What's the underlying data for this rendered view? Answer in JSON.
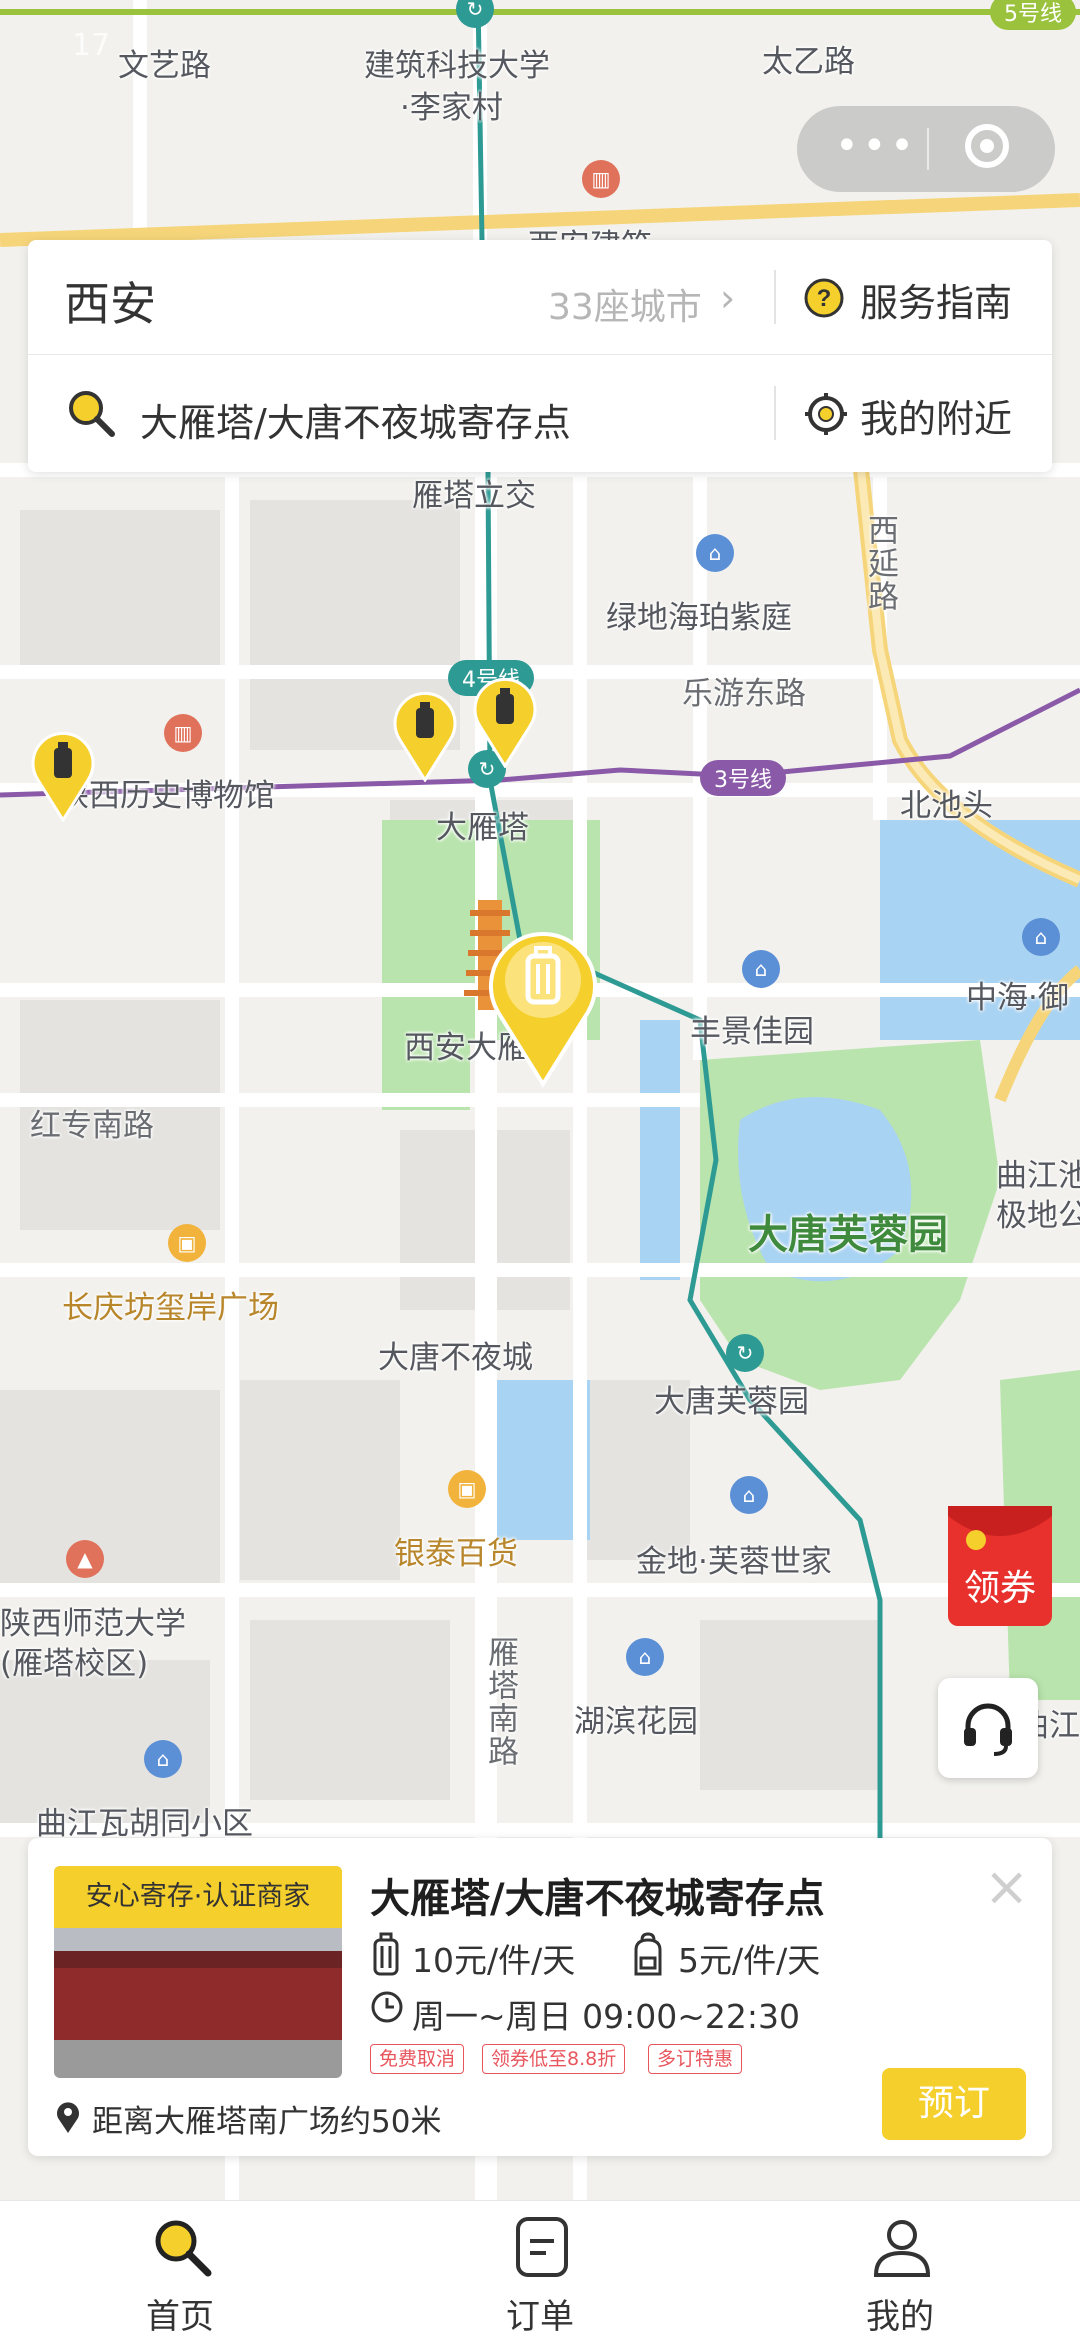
{
  "map": {
    "labels": {
      "wenyi_road": "文艺路",
      "jianzhu_station": "建筑科技大学",
      "lijiacun": "·李家村",
      "taiyi_road": "太乙路",
      "yanta_lijiao": "雁塔立交",
      "xiyan_road": "西延路",
      "lvdi": "绿地海珀紫庭",
      "leyou_road": "乐游东路",
      "museum": "陕西历史博物馆",
      "beichitou": "北池头",
      "dayanta_station": "大雁塔",
      "zhonghai": "中海·御",
      "xian_dayanta": "西安大雁塔",
      "fengjing": "丰景佳园",
      "hongzhuan_road": "红专南路",
      "qujiang_chi": "曲江池",
      "jidi": "极地公",
      "furong_park": "大唐芙蓉园",
      "changqingfang": "长庆坊玺岸广场",
      "budaocheng": "大唐不夜城",
      "furong_station": "大唐芙蓉园",
      "yintai": "银泰百货",
      "jindi": "金地·芙蓉世家",
      "shida": "陕西师范大学",
      "shida_campus": "(雁塔校区)",
      "yanta_south_road": "雁塔南路",
      "hubin": "湖滨花园",
      "wahutong": "曲江瓦胡同小区",
      "qujiang_right": "曲江",
      "xiyan_top": "西安建筑"
    },
    "line_badges": {
      "line5": "5号线",
      "line4": "4号线",
      "line3": "3号线"
    },
    "colors": {
      "line3": "#8a5aa8",
      "line4": "#2e9a94",
      "line5": "#9ac23c",
      "park": "#b9e4ad",
      "water": "#a9d3f2",
      "pin": "#f5cf2b"
    }
  },
  "capsule": {
    "more_icon": "more-dots-icon",
    "close_icon": "target-circle-icon"
  },
  "search_card": {
    "city": "西安",
    "city_count": "33座城市",
    "guide_label": "服务指南",
    "search_value": "大雁塔/大唐不夜城寄存点",
    "nearby_label": "我的附近"
  },
  "coupon": {
    "label": "领券"
  },
  "store": {
    "badge": "安心寄存·认证商家",
    "title": "大雁塔/大唐不夜城寄存点",
    "luggage_price": "10元/件/天",
    "bag_price": "5元/件/天",
    "hours": "周一~周日 09:00~22:30",
    "tags": [
      "免费取消",
      "领券低至8.8折",
      "多订特惠"
    ],
    "distance": "距离大雁塔南广场约50米",
    "book_label": "预订"
  },
  "tabs": [
    {
      "label": "首页",
      "icon": "search-icon"
    },
    {
      "label": "订单",
      "icon": "order-icon"
    },
    {
      "label": "我的",
      "icon": "user-icon"
    }
  ]
}
